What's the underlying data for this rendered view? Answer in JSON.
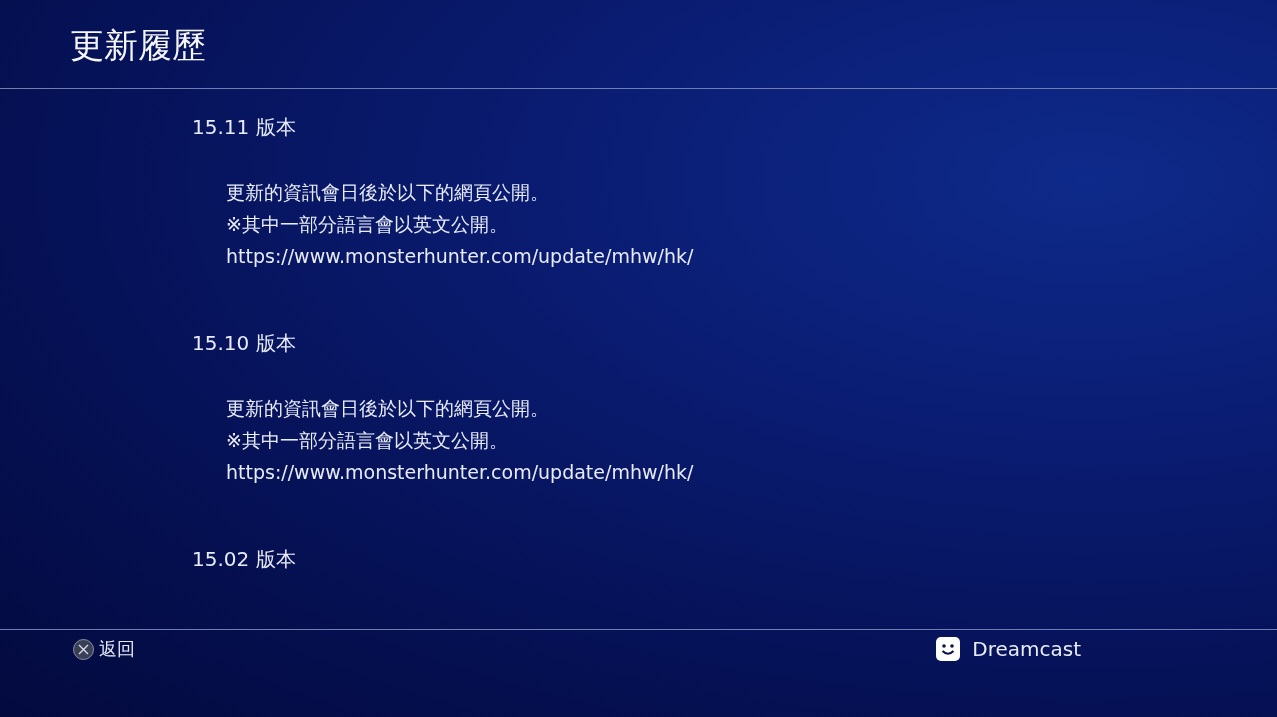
{
  "title": "更新履歷",
  "versions": [
    {
      "label": "15.11 版本",
      "lines": [
        "更新的資訊會日後於以下的網頁公開。",
        "※其中一部分語言會以英文公開。",
        "https://www.monsterhunter.com/update/mhw/hk/"
      ]
    },
    {
      "label": "15.10 版本",
      "lines": [
        "更新的資訊會日後於以下的網頁公開。",
        "※其中一部分語言會以英文公開。",
        "https://www.monsterhunter.com/update/mhw/hk/"
      ]
    },
    {
      "label": "15.02 版本"
    }
  ],
  "footer": {
    "back": "返回",
    "user": "Dreamcast"
  }
}
